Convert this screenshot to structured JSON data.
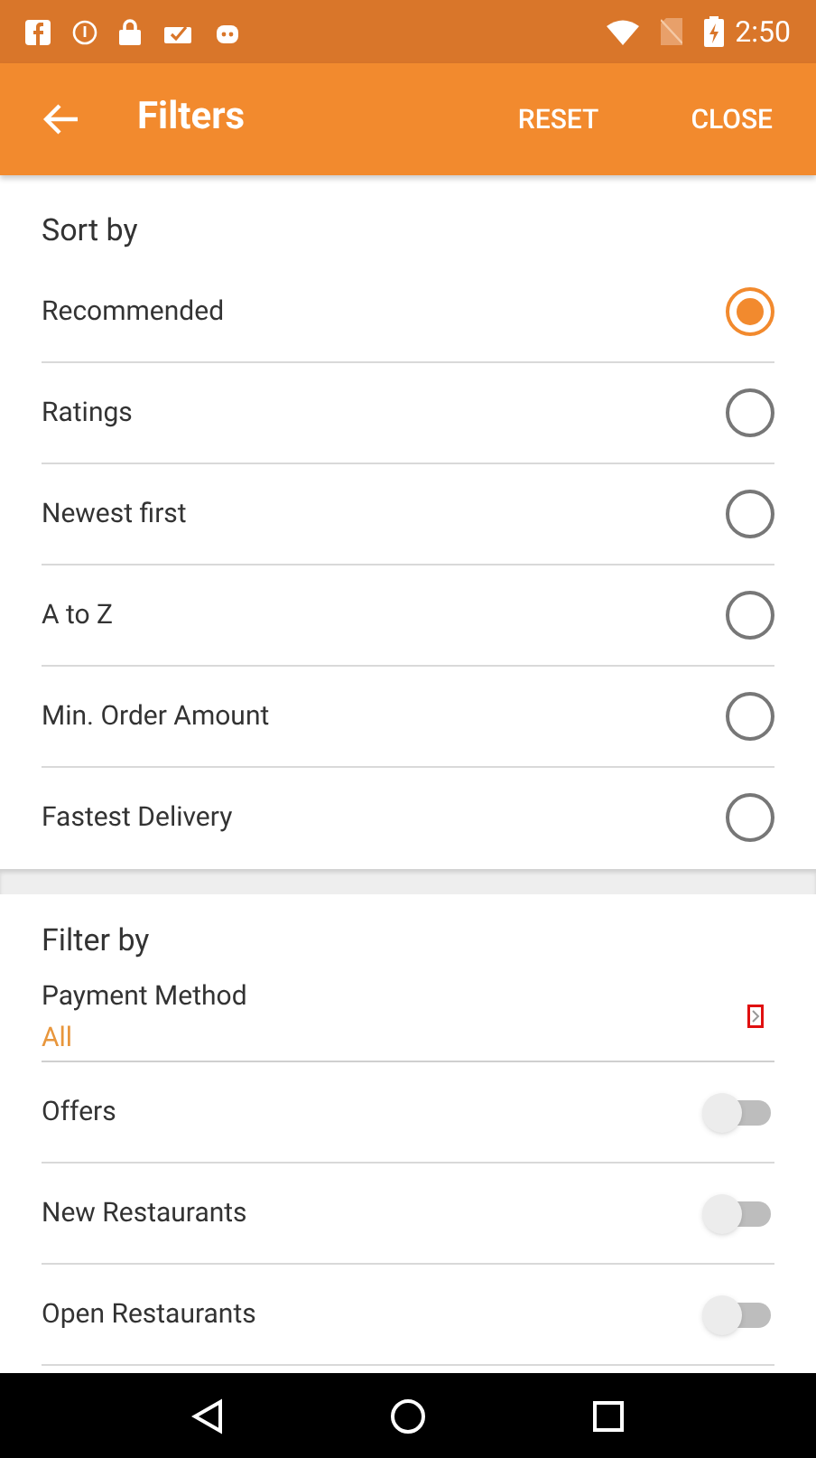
{
  "status_bar": {
    "time": "2:50"
  },
  "app_bar": {
    "title": "Filters",
    "actions": [
      "RESET",
      "CLOSE"
    ]
  },
  "sort": {
    "heading": "Sort by",
    "options": [
      {
        "label": "Recommended",
        "selected": true
      },
      {
        "label": "Ratings",
        "selected": false
      },
      {
        "label": "Newest first",
        "selected": false
      },
      {
        "label": "A to Z",
        "selected": false
      },
      {
        "label": "Min. Order Amount",
        "selected": false
      },
      {
        "label": "Fastest Delivery",
        "selected": false
      }
    ]
  },
  "filter": {
    "heading": "Filter by",
    "payment": {
      "label": "Payment Method",
      "value": "All"
    },
    "toggles": [
      {
        "label": "Offers",
        "on": false
      },
      {
        "label": "New Restaurants",
        "on": false
      },
      {
        "label": "Open Restaurants",
        "on": false
      }
    ]
  }
}
